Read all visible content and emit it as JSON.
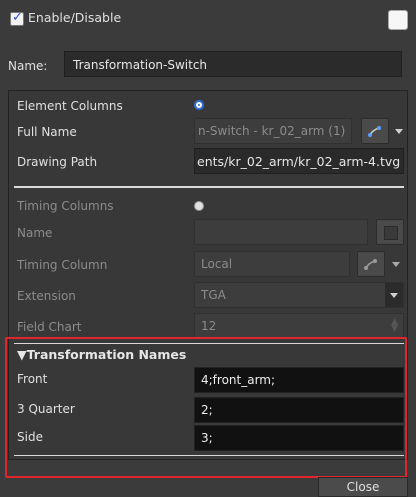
{
  "header": {
    "enable_label": "Enable/Disable",
    "name_label": "Name:",
    "name_value": "Transformation-Switch"
  },
  "element_columns": {
    "label": "Element Columns",
    "full_name_label": "Full Name",
    "full_name_value": "n-Switch - kr_02_arm (1)",
    "drawing_path_label": "Drawing Path",
    "drawing_path_value": "ents/kr_02_arm/kr_02_arm-4.tvg"
  },
  "timing_columns": {
    "label": "Timing Columns",
    "name_label": "Name",
    "name_value": "",
    "timing_column_label": "Timing Column",
    "timing_column_value": "Local",
    "extension_label": "Extension",
    "extension_value": "TGA",
    "field_chart_label": "Field Chart",
    "field_chart_value": "12"
  },
  "transformation_names": {
    "title": "Transformation Names",
    "rows": [
      {
        "label": "Front",
        "value": "4;front_arm;"
      },
      {
        "label": "3 Quarter",
        "value": "2;"
      },
      {
        "label": "Side",
        "value": "3;"
      }
    ]
  },
  "footer": {
    "close_label": "Close"
  },
  "icons": {
    "checkbox": "checkbox-checked-icon",
    "radio_selected": "radio-selected-icon",
    "radio_unselected": "radio-unselected-icon",
    "link": "link-icon",
    "dropdown": "chevron-down-icon",
    "spinner": "spinner-arrows-icon",
    "triangle": "triangle-down-icon"
  },
  "colors": {
    "background": "#3b3b3b",
    "highlight": "#e0262b",
    "radio_accent": "#2f6fd8"
  }
}
